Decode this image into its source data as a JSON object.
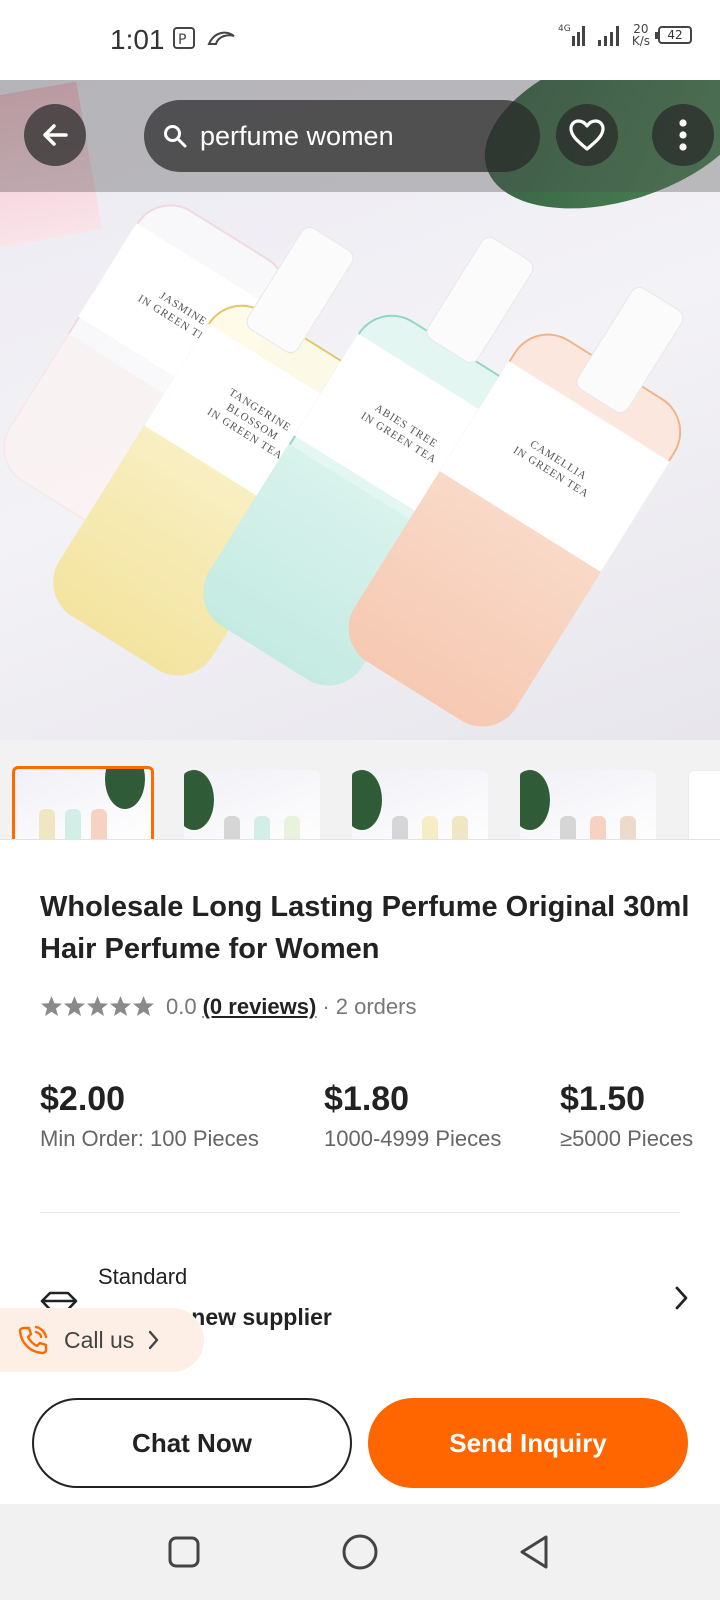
{
  "status_bar": {
    "time": "1:01",
    "network_speed_value": "20",
    "network_speed_unit": "K/s",
    "battery": "42",
    "signal_label": "4G"
  },
  "search": {
    "query": "perfume women"
  },
  "product_image": {
    "bottle_labels": [
      "JASMINE\nIN GREEN TEA",
      "TANGERINE\nBLOSSOM\nIN GREEN TEA",
      "ABIES TREE\nIN GREEN TEA",
      "CAMELLIA\nIN GREEN TEA"
    ]
  },
  "product": {
    "title": "Wholesale Long Lasting Perfume Original 30ml Hair Perfume for Women",
    "rating_value": "0.0",
    "reviews_label": "(0 reviews)",
    "orders_label": "· 2 orders"
  },
  "prices": [
    {
      "price": "$2.00",
      "quantity": "Min Order: 100 Pieces"
    },
    {
      "price": "$1.80",
      "quantity": "1000-4999 Pieces"
    },
    {
      "price": "$1.50",
      "quantity": "≥5000 Pieces"
    }
  ],
  "standard": {
    "label": "Standard",
    "subtitle": "ff with a new supplier"
  },
  "call_us": {
    "label": "Call us"
  },
  "actions": {
    "chat_now": "Chat Now",
    "send_inquiry": "Send Inquiry"
  },
  "colors": {
    "accent": "#ff6600",
    "active_thumb_border": "#ff6a00"
  }
}
